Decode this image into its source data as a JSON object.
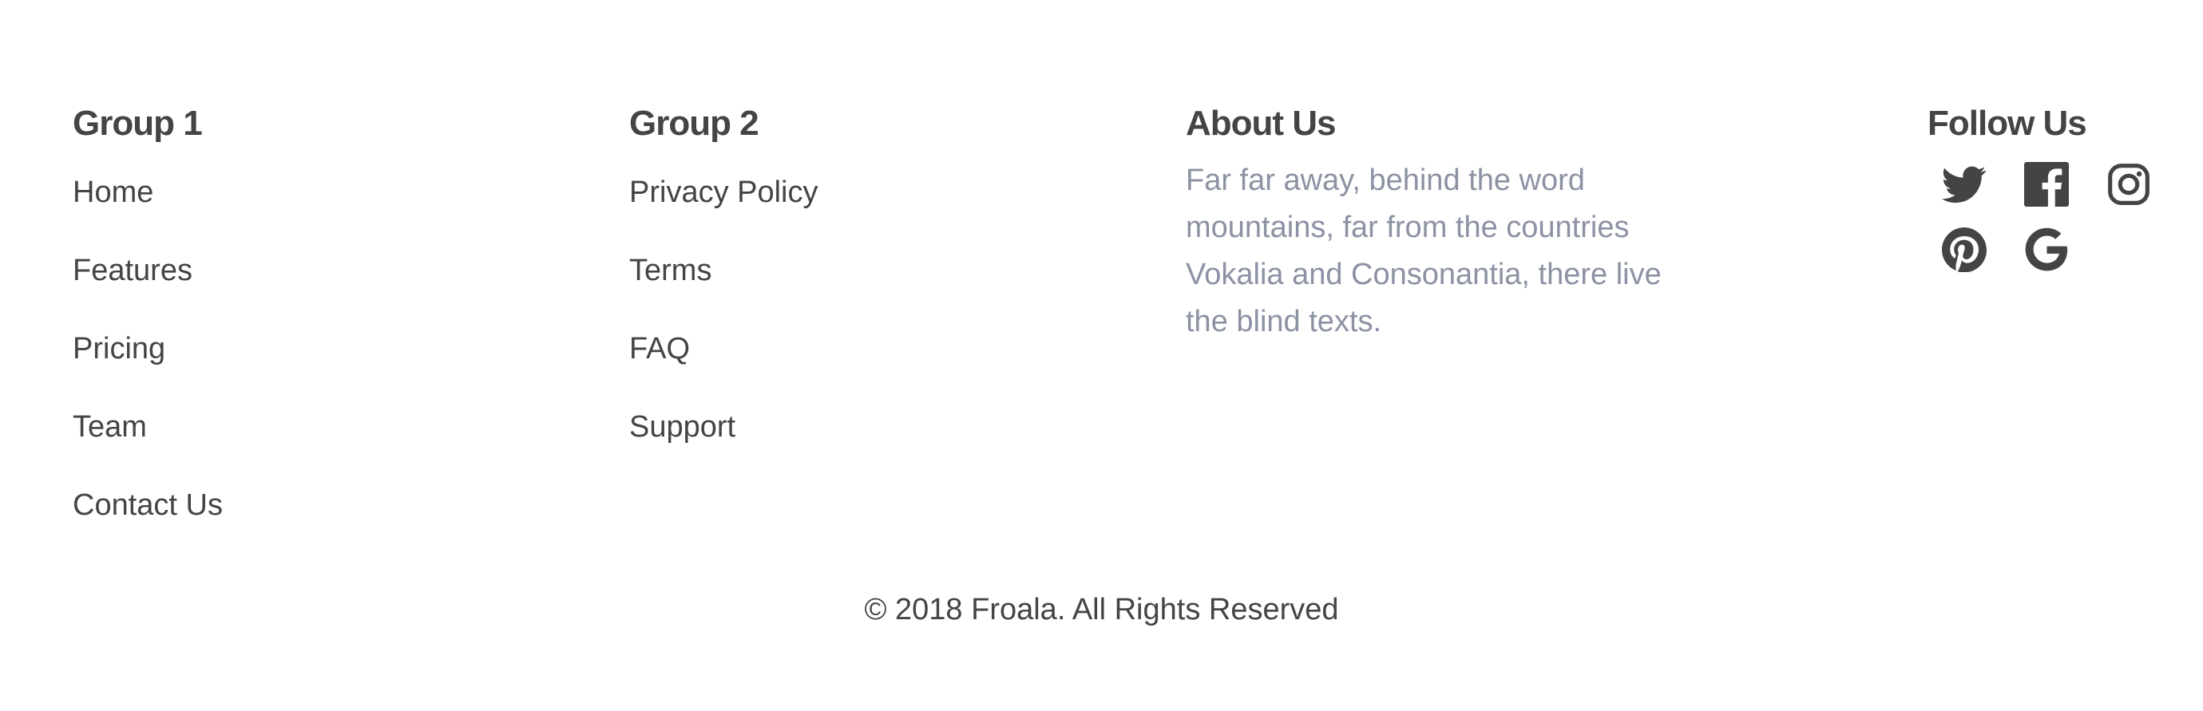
{
  "groups": [
    {
      "title": "Group 1",
      "links": [
        "Home",
        "Features",
        "Pricing",
        "Team",
        "Contact Us"
      ]
    },
    {
      "title": "Group 2",
      "links": [
        "Privacy Policy",
        "Terms",
        "FAQ",
        "Support"
      ]
    }
  ],
  "about": {
    "title": "About Us",
    "text": "Far far away, behind the word mountains, far from the countries Vokalia and Consonantia, there live the blind texts."
  },
  "follow": {
    "title": "Follow Us",
    "icons": [
      "twitter-icon",
      "facebook-icon",
      "instagram-icon",
      "pinterest-icon",
      "google-icon"
    ]
  },
  "copyright": "© 2018 Froala. All Rights Reserved",
  "colors": {
    "text": "#444444",
    "muted": "#8c92a3",
    "background": "#ffffff"
  }
}
